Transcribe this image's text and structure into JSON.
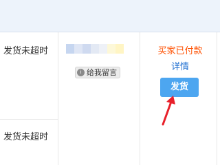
{
  "rows": [
    {
      "status": "发货未超时"
    },
    {
      "status": "发货未超时"
    }
  ],
  "message_button": {
    "icon": "message-icon",
    "icon_glyph": "i",
    "label": "给我留言"
  },
  "order": {
    "state": "买家已付款",
    "detail_link": "详情",
    "ship_button": "发货"
  },
  "colors": {
    "state_orange": "#ff5000",
    "link_blue": "#1f6fd1",
    "button_blue": "#4da6f0",
    "arrow_red": "#e8202a",
    "header_band": "#edf3fb"
  }
}
